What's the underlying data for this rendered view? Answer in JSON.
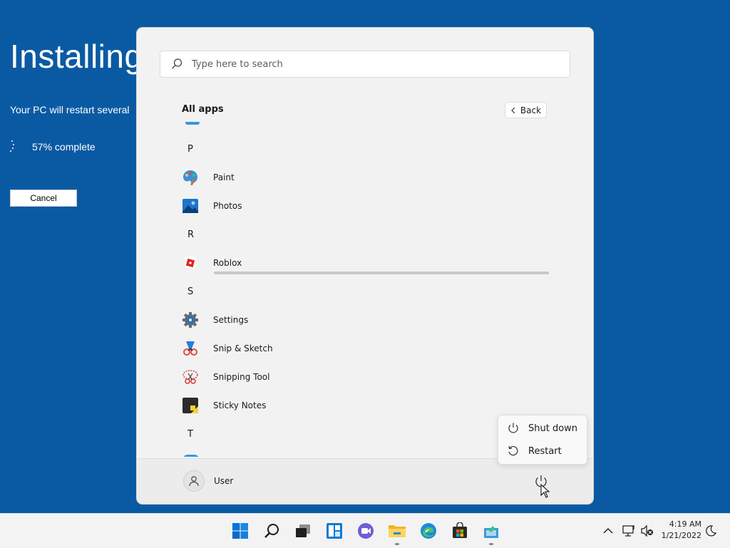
{
  "installer": {
    "title": "Installing",
    "subtitle": "Your PC will restart several",
    "progress": "57% complete",
    "cancel_label": "Cancel"
  },
  "start_menu": {
    "search_placeholder": "Type here to search",
    "section_title": "All apps",
    "back_label": "Back",
    "apps": [
      {
        "type": "letter",
        "label": "P"
      },
      {
        "type": "app",
        "label": "Paint",
        "icon": "paint-icon"
      },
      {
        "type": "app",
        "label": "Photos",
        "icon": "photos-icon"
      },
      {
        "type": "letter",
        "label": "R"
      },
      {
        "type": "app",
        "label": "Roblox",
        "icon": "roblox-icon"
      },
      {
        "type": "letter",
        "label": "S"
      },
      {
        "type": "app",
        "label": "Settings",
        "icon": "settings-gear-icon"
      },
      {
        "type": "app",
        "label": "Snip & Sketch",
        "icon": "snip-sketch-icon"
      },
      {
        "type": "app",
        "label": "Snipping Tool",
        "icon": "snipping-tool-icon"
      },
      {
        "type": "app",
        "label": "Sticky Notes",
        "icon": "sticky-notes-icon"
      },
      {
        "type": "letter",
        "label": "T"
      }
    ],
    "user_name": "User",
    "power_menu": {
      "shutdown_label": "Shut down",
      "restart_label": "Restart"
    }
  },
  "taskbar": {
    "icons": [
      "windows-start-icon",
      "search-icon",
      "task-view-icon",
      "widgets-icon",
      "chat-icon",
      "file-explorer-icon",
      "edge-icon",
      "store-icon",
      "setup-icon"
    ],
    "clock_time": "4:19 AM",
    "clock_date": "1/21/2022"
  },
  "colors": {
    "background": "#0a5aa3",
    "start_bg": "#f2f2f2",
    "taskbar_bg": "#f3f3f3",
    "accent": "#0078d4"
  }
}
